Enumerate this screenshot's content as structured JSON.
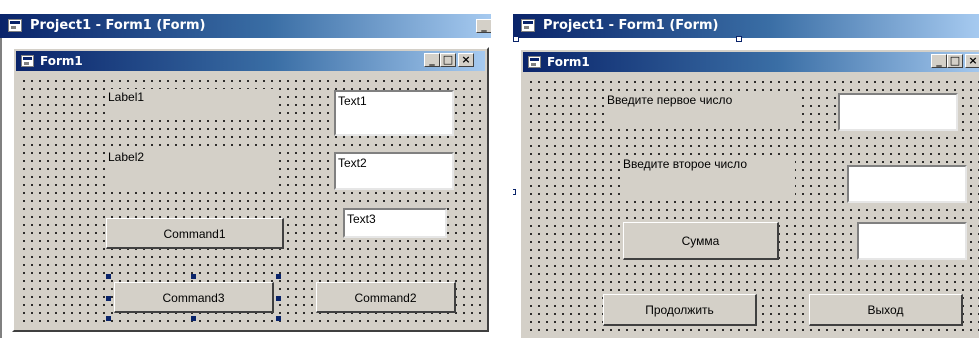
{
  "left": {
    "outer_title": "Project1 - Form1 (Form)",
    "form_title": "Form1",
    "label1": "Label1",
    "label2": "Label2",
    "text1": "Text1",
    "text2": "Text2",
    "text3": "Text3",
    "command1": "Command1",
    "command3": "Command3",
    "command2": "Command2"
  },
  "right": {
    "outer_title": "Project1 - Form1 (Form)",
    "form_title": "Form1",
    "label_first": "Введите первое число",
    "label_second": "Введите второе число",
    "sum_button": "Сумма",
    "continue_button": "Продолжить",
    "exit_button": "Выход",
    "text1": "",
    "text2": "",
    "text3": ""
  },
  "titlebar_buttons": {
    "minimize": "_",
    "maximize": "□",
    "close": "×"
  },
  "colors": {
    "title_active_start": "#0a246a",
    "title_active_end": "#a6caf0",
    "face": "#d4d0c8",
    "selection_handle": "#0a246a"
  }
}
